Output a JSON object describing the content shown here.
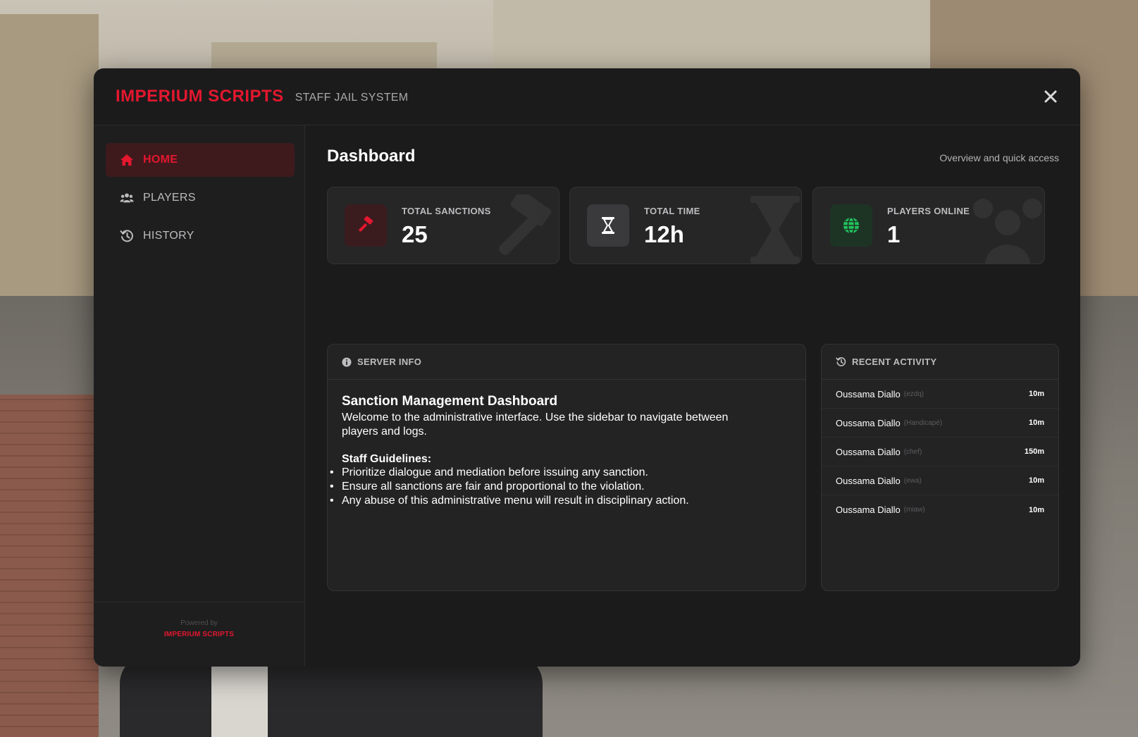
{
  "header": {
    "brand": "IMPERIUM SCRIPTS",
    "subtitle": "STAFF JAIL SYSTEM",
    "close_icon": "close-icon"
  },
  "sidebar": {
    "items": [
      {
        "label": "HOME",
        "icon": "home-icon",
        "active": true
      },
      {
        "label": "PLAYERS",
        "icon": "users-icon",
        "active": false
      },
      {
        "label": "HISTORY",
        "icon": "history-icon",
        "active": false
      }
    ],
    "footer": {
      "powered_by": "Powered by",
      "brand": "IMPERIUM SCRIPTS"
    }
  },
  "main": {
    "title": "Dashboard",
    "subtitle": "Overview and quick access",
    "stats": [
      {
        "label": "TOTAL SANCTIONS",
        "value": "25",
        "icon": "gavel-icon",
        "accent": "#e3172e"
      },
      {
        "label": "TOTAL TIME",
        "value": "12h",
        "icon": "hourglass-icon",
        "accent": "#ffffff"
      },
      {
        "label": "PLAYERS ONLINE",
        "value": "1",
        "icon": "globe-icon",
        "accent": "#22c55e"
      }
    ],
    "server_info": {
      "heading": "SERVER INFO",
      "title": "Sanction Management Dashboard",
      "text": "Welcome to the administrative interface. Use the sidebar to navigate between players and logs.",
      "guidelines_title": "Staff Guidelines:",
      "guidelines": [
        "Prioritize dialogue and mediation before issuing any sanction.",
        "Ensure all sanctions are fair and proportional to the violation.",
        "Any abuse of this administrative menu will result in disciplinary action."
      ]
    },
    "recent_activity": {
      "heading": "RECENT ACTIVITY",
      "items": [
        {
          "name": "Oussama Diallo",
          "tag": "(ezdq)",
          "time": "10m"
        },
        {
          "name": "Oussama Diallo",
          "tag": "(Handicapé)",
          "time": "10m"
        },
        {
          "name": "Oussama Diallo",
          "tag": "(chef)",
          "time": "150m"
        },
        {
          "name": "Oussama Diallo",
          "tag": "(ewa)",
          "time": "10m"
        },
        {
          "name": "Oussama Diallo",
          "tag": "(miaw)",
          "time": "10m"
        }
      ]
    }
  },
  "colors": {
    "accent": "#e3172e",
    "panel": "#1b1b1c",
    "card": "#262627",
    "online": "#22c55e"
  }
}
